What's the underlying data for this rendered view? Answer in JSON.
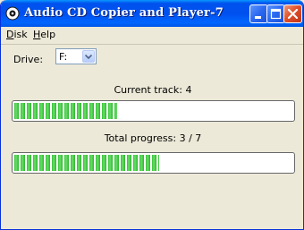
{
  "window": {
    "title": "Audio CD Copier and Player-7"
  },
  "menu": {
    "disk": {
      "hotkey": "D",
      "rest": "isk"
    },
    "help": {
      "hotkey": "H",
      "rest": "elp"
    }
  },
  "drive": {
    "label": "Drive:",
    "value": "F:"
  },
  "current_track": {
    "label": "Current track: 4",
    "progress_fraction": 0.37
  },
  "total_progress": {
    "label": "Total progress: 3 / 7",
    "progress_fraction": 0.52
  },
  "colors": {
    "title_blue": "#0050ee",
    "progress_green": "#31c131",
    "close_red": "#e0502a"
  },
  "icons": [
    "cd-icon",
    "minimize-icon",
    "maximize-icon",
    "close-icon",
    "chevron-down-icon"
  ]
}
